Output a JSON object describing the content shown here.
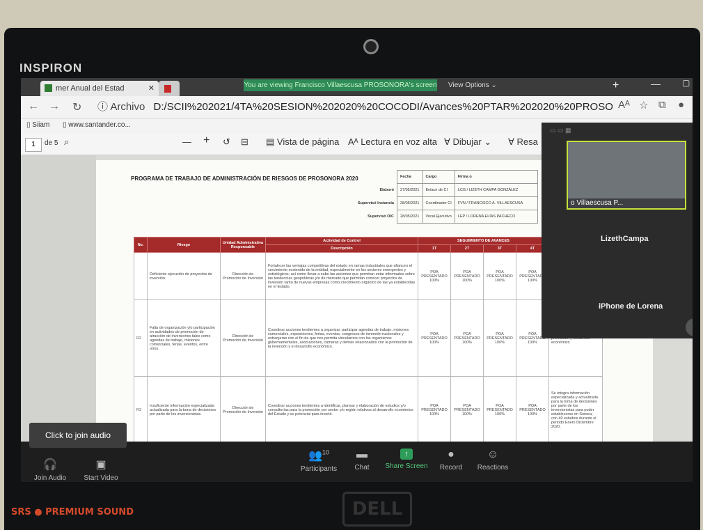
{
  "laptop": {
    "brand": "INSPIRON",
    "audio_badge": "SRS ● PREMIUM SOUND",
    "logo": "DELL"
  },
  "browser": {
    "tab_title": "mer Anual del Estad",
    "tab_close": "✕",
    "tab2_short": "ud",
    "viewing_banner": "You are viewing Francisco Villaescusa PROSONORA's screen",
    "view_options": "View Options ⌄",
    "new_tab": "+",
    "address_prefix": "ⓘ Archivo",
    "address": "D:/SCII%202021/4TA%20SESION%202020%20COCODI/Avances%20PTAR%202020%20PROSONORA%20-%204to.%20Trim...",
    "bookmarks": [
      "Siiam",
      "www.santander.co..."
    ]
  },
  "pdf_toolbar": {
    "page": "1",
    "of": "de 5",
    "minus": "—",
    "plus": "+",
    "vista": "Vista de página",
    "lectura": "Lectura en voz alta",
    "dibujar": "Dibujar",
    "resaltar": "Resa"
  },
  "document": {
    "title": "PROGRAMA DE TRABAJO DE ADMINISTRACIÓN DE RIESGOS DE PROSONORA 2020",
    "meta_headers": [
      "Fecha",
      "Cargo",
      "Firma o"
    ],
    "meta_rows": [
      {
        "label": "Elaboró",
        "fecha": "27/05/2021",
        "cargo": "Enlace de CI",
        "firma": "LCG / LIZETH CAMPA GONZÁLEZ"
      },
      {
        "label": "Supervisó Instancia",
        "fecha": "28/05/2021",
        "cargo": "Coordinador CI",
        "firma": "FVN / FRANCISCO A. VILLAESCUSA"
      },
      {
        "label": "Supervisó OIC",
        "fecha": "28/05/2021",
        "cargo": "Vocal Ejecutivo",
        "firma": "LEP / LORENA ELÍAS PACHECO"
      }
    ],
    "headers": {
      "no": "No.",
      "riesgo": "Riesgo",
      "unidad": "Unidad Administrativa Responsable",
      "actividad": "Actividad de Control",
      "descripcion": "Descripción",
      "seguimiento": "SEGUIMIENTO DE AVANCES",
      "q1": "1T",
      "q2": "2T",
      "q3": "3T",
      "q4": "4T"
    },
    "rows": [
      {
        "no": "",
        "riesgo": "Deficiente ejecución de proyectos de inversión.",
        "unidad": "Dirección de Promoción de Inversión",
        "descripcion": "Fortalecer las ventajas competitivas del estado en ramas industriales que afiancen el crecimiento sostenido de la entidad, especialmente en los sectores emergentes y estratégicos; así como llevar a cabo las acciones que permitan estar informados sobre las tendencias geopolíticas y/o de mercado que permitan conocer proyectos de inversión tanto de nuevas empresas como crecimiento orgánico de las ya establecidas en el Estado.",
        "q1": "POA PRESENTADO 100%",
        "q2": "POA PRESENTADO 100%",
        "q3": "POA PRESENTADO 100%",
        "q4": "POA PRESENTADO 100%",
        "obs": ""
      },
      {
        "no": "R2",
        "riesgo": "Falta de organización y/o participación en actividades de promoción de atracción de inversiones tales como agendas de trabajo, misiones comerciales, ferias, eventos, entre otros.",
        "unidad": "Dirección de Promoción de Inversión",
        "descripcion": "Coordinar acciones tendientes a organizar, participar agendas de trabajo, misiones comerciales, exposiciones, ferias, eventos, congresos de inversión nacionales y extranjeras con el fin de que nos permita vincularnos con los organismos gubernamentales, asociaciones, cámaras y demás relacionados con la promoción de la inversión y el desarrollo económico.",
        "q1": "POA PRESENTADO 100%",
        "q2": "POA PRESENTADO 100%",
        "q3": "POA PRESENTADO 100%",
        "q4": "POA PRESENTADO 100%",
        "obs": "actores relacionados con la promoción y desarrollo económico"
      },
      {
        "no": "R3",
        "riesgo": "Insuficiente información especializada actualizada para la toma de decisiones por parte de los inversionistas.",
        "unidad": "Dirección de Promoción de Inversión",
        "descripcion": "Coordinar acciones tendientes a identificar, planear y elaboración de estudios y/o consultorías para la promoción por sector y/o región relativos al desarrollo económico del Estado y su potencial para invertir.",
        "q1": "POA PRESENTADO 100%",
        "q2": "POA PRESENTADO 100%",
        "q3": "POA PRESENTADO 100%",
        "q4": "POA PRESENTADO 100%",
        "obs": "Se integra información especializada y actualizada para la toma de decisiones por parte de los inversionistas para poder establecerse en Sonora, con 40 estudios durante el periodo Enero Diciembre 2020."
      }
    ]
  },
  "zoom": {
    "tile_caption": "o Villaescusa P...",
    "participant1": "LizethCampa",
    "participant2": "iPhone de Lorena",
    "next": "›",
    "audio_tip": "Click to join audio",
    "join_audio": "Join Audio",
    "start_video": "Start Video",
    "participants_count": "10",
    "participants": "Participants",
    "chat": "Chat",
    "share": "Share Screen",
    "record": "Record",
    "reactions": "Reactions"
  }
}
